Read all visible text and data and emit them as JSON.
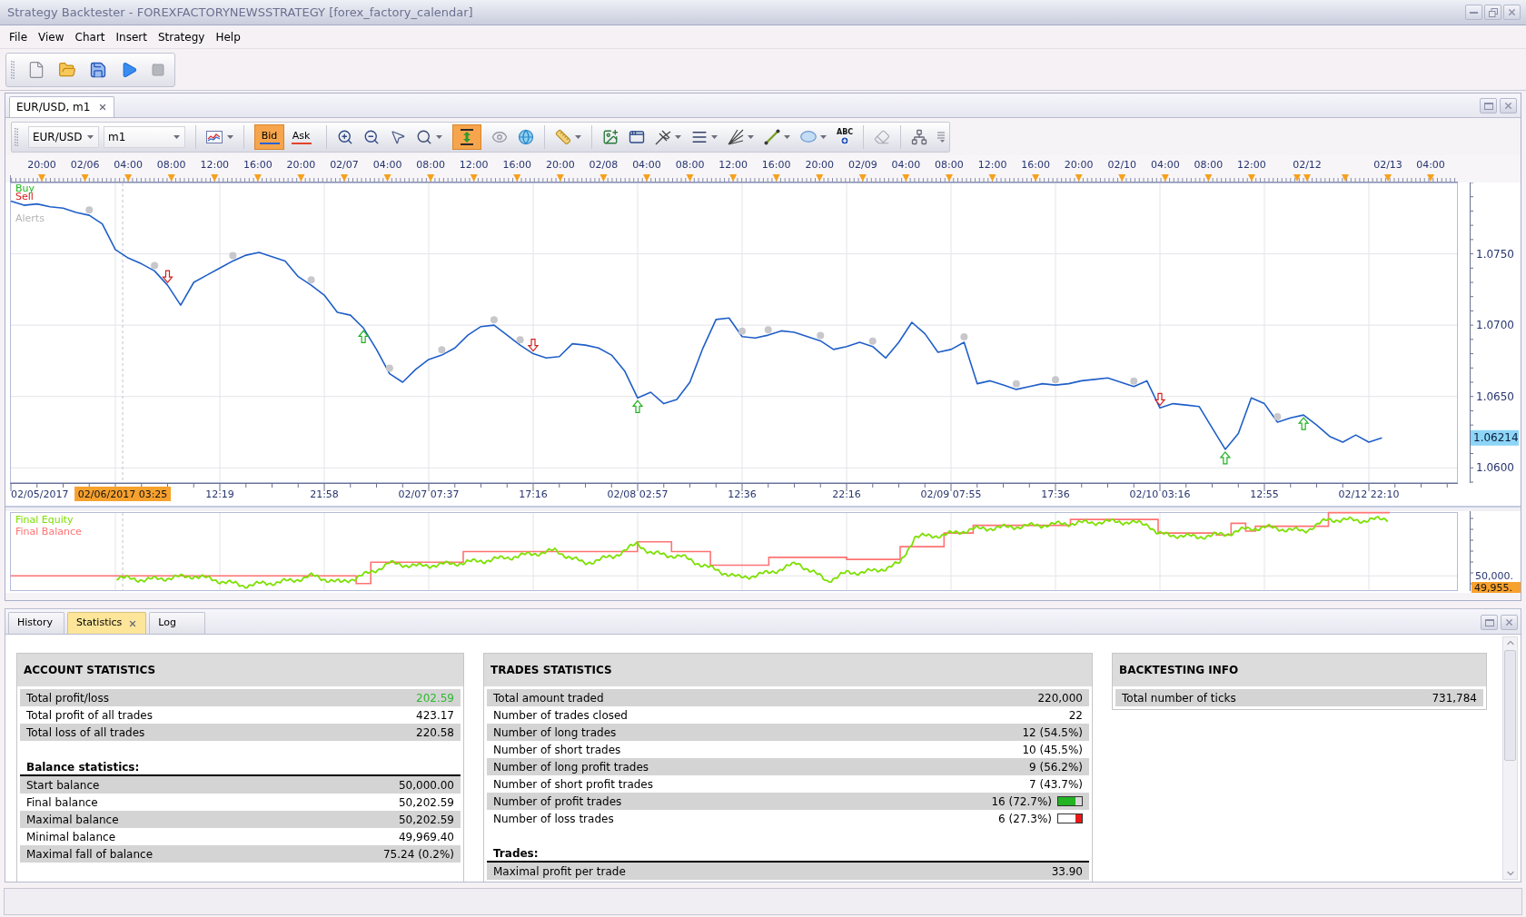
{
  "window": {
    "title": "Strategy Backtester - FOREXFACTORYNEWSSTRATEGY [forex_factory_calendar]"
  },
  "menu": [
    "File",
    "View",
    "Chart",
    "Insert",
    "Strategy",
    "Help"
  ],
  "chart_window": {
    "tabs": [
      {
        "label": "EUR/USD, m1",
        "selected": true
      }
    ],
    "toolbar": {
      "instrument": "EUR/USD",
      "period": "m1",
      "price_sides": [
        {
          "label": "Bid",
          "selected": true,
          "color": "#2a62d2"
        },
        {
          "label": "Ask",
          "selected": false,
          "color": "#e2442a"
        }
      ],
      "autoscale_on": true,
      "text_tool": "ABC"
    },
    "time_ruler": [
      "20:00",
      "02/06",
      "04:00",
      "08:00",
      "12:00",
      "16:00",
      "20:00",
      "02/07",
      "04:00",
      "08:00",
      "12:00",
      "16:00",
      "20:00",
      "02/08",
      "04:00",
      "08:00",
      "12:00",
      "16:00",
      "20:00",
      "02/09",
      "04:00",
      "08:00",
      "12:00",
      "16:00",
      "20:00",
      "02/10",
      "04:00",
      "08:00",
      "12:00",
      "02/12",
      "02/13",
      "04:00"
    ],
    "price_chart": {
      "legend": [
        {
          "label": "Buy",
          "color": "#1fb81f"
        },
        {
          "label": "Sell",
          "color": "#d81e1e"
        },
        {
          "label": "Alerts",
          "color": "#b4b4b4"
        }
      ],
      "last_price": "1.06214",
      "axis_start_label": "02/05/2017",
      "cursor_label": "02/06/2017 03:25",
      "chart_data": [
        {
          "type": "line",
          "categories": [
            null,
            null,
            null,
            null,
            null,
            null,
            null,
            null,
            null,
            null,
            null,
            null,
            null,
            null,
            null,
            null,
            "12:19",
            null,
            null,
            null,
            null,
            null,
            null,
            null,
            "21:58",
            null,
            null,
            null,
            null,
            null,
            null,
            null,
            "02/07 07:37",
            null,
            null,
            null,
            null,
            null,
            null,
            null,
            "17:16",
            null,
            null,
            null,
            null,
            null,
            null,
            null,
            "02/08 02:57",
            null,
            null,
            null,
            null,
            null,
            null,
            null,
            "12:36",
            null,
            null,
            null,
            null,
            null,
            null,
            null,
            "22:16",
            null,
            null,
            null,
            null,
            null,
            null,
            null,
            "02/09 07:55",
            null,
            null,
            null,
            null,
            null,
            null,
            null,
            "17:36",
            null,
            null,
            null,
            null,
            null,
            null,
            null,
            "02/10 03:16",
            null,
            null,
            null,
            null,
            null,
            null,
            null,
            "12:55",
            null,
            null,
            null,
            null,
            null,
            null,
            null,
            "02/12 22:10",
            null
          ],
          "ylim": [
            1.059,
            1.08
          ],
          "yticks": [
            {
              "value": 1.06,
              "label": "1.0600"
            },
            {
              "value": 1.065,
              "label": "1.0650"
            },
            {
              "value": 1.07,
              "label": "1.0700"
            },
            {
              "value": 1.075,
              "label": "1.0750"
            }
          ],
          "grid": true,
          "series": [
            {
              "color": "#1f5fc8",
              "values": [
                1.0787,
                1.0784,
                1.0785,
                1.0783,
                1.0782,
                1.0779,
                1.0777,
                1.0771,
                1.0753,
                1.0747,
                1.0743,
                1.0738,
                1.0728,
                1.0714,
                1.073,
                1.0735,
                1.074,
                1.0745,
                1.0749,
                1.0751,
                1.0748,
                1.0745,
                1.0734,
                1.0728,
                1.0721,
                1.0709,
                1.0707,
                1.0698,
                1.0683,
                1.0666,
                1.066,
                1.0669,
                1.0676,
                1.0679,
                1.0684,
                1.0693,
                1.0699,
                1.07,
                1.0693,
                1.0686,
                1.068,
                1.0677,
                1.0678,
                1.0687,
                1.0686,
                1.0684,
                1.0679,
                1.0668,
                1.0649,
                1.0653,
                1.0645,
                1.0648,
                1.066,
                1.0684,
                1.0704,
                1.0705,
                1.0692,
                1.0691,
                1.0693,
                1.0696,
                1.0695,
                1.0692,
                1.0689,
                1.0683,
                1.0685,
                1.0688,
                1.0685,
                1.0677,
                1.0688,
                1.0702,
                1.0694,
                1.0681,
                1.0683,
                1.0688,
                1.0659,
                1.0661,
                1.0658,
                1.0655,
                1.0657,
                1.0659,
                1.0658,
                1.0659,
                1.0661,
                1.0662,
                1.0663,
                1.066,
                1.0657,
                1.0661,
                1.0642,
                1.0645,
                1.0644,
                1.0643,
                1.0628,
                1.0613,
                1.0624,
                1.0649,
                1.0645,
                1.0632,
                1.0635,
                1.0637,
                1.063,
                1.0622,
                1.0618,
                1.0623,
                1.0618,
                1.0621
              ]
            }
          ]
        }
      ]
    },
    "equity_chart": {
      "legend": [
        {
          "label": "Final Equity",
          "color": "#7de000"
        },
        {
          "label": "Final Balance",
          "color": "#ff7373"
        }
      ],
      "axis_label": "50,000.",
      "current_value": "49,955."
    }
  },
  "bottom_panel": {
    "tabs": [
      {
        "label": "History",
        "selected": false
      },
      {
        "label": "Statistics",
        "selected": true
      },
      {
        "label": "Log",
        "selected": false
      }
    ],
    "panels": [
      {
        "title": "ACCOUNT STATISTICS",
        "groups": [
          {
            "rows": [
              {
                "label": "Total profit/loss",
                "value": "202.59",
                "color": "#2eb82e"
              },
              {
                "label": "Total profit of all trades",
                "value": "423.17"
              },
              {
                "label": "Total loss of all trades",
                "value": "220.58"
              }
            ]
          },
          {
            "heading": "Balance statistics:",
            "rows": [
              {
                "label": "Start balance",
                "value": "50,000.00"
              },
              {
                "label": "Final balance",
                "value": "50,202.59"
              },
              {
                "label": "Maximal balance",
                "value": "50,202.59"
              },
              {
                "label": "Minimal balance",
                "value": "49,969.40"
              },
              {
                "label": "Maximal fall of balance",
                "value": "75.24 (0.2%)"
              }
            ]
          }
        ]
      },
      {
        "title": "TRADES STATISTICS",
        "groups": [
          {
            "rows": [
              {
                "label": "Total amount traded",
                "value": "220,000",
                "kind": "text"
              },
              {
                "label": "Number of trades closed",
                "value": "22",
                "kind": "text"
              },
              {
                "label": "Number of long trades",
                "value": "12 (54.5%)",
                "kind": "text"
              },
              {
                "label": "Number of short trades",
                "value": "10 (45.5%)",
                "kind": "text"
              },
              {
                "label": "Number of long profit trades",
                "value": "9 (56.2%)",
                "kind": "text"
              },
              {
                "label": "Number of short profit trades",
                "value": "7 (43.7%)",
                "kind": "text"
              },
              {
                "label": "Number of profit trades",
                "value": "16 (72.7%)",
                "kind": "gain",
                "level": 0.727
              },
              {
                "label": "Number of loss trades",
                "value": "6 (27.3%)",
                "kind": "loss",
                "level": 0.273
              }
            ]
          },
          {
            "heading": "Trades:",
            "rows": [
              {
                "label": "Maximal profit per trade",
                "value": "33.90"
              }
            ]
          }
        ]
      },
      {
        "title": "BACKTESTING INFO",
        "groups": [
          {
            "rows": [
              {
                "label": "Total number of ticks",
                "value": "731,784"
              }
            ]
          }
        ]
      }
    ]
  }
}
